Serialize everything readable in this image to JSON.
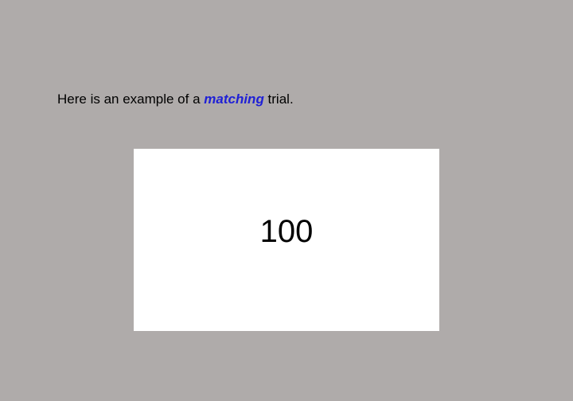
{
  "instruction": {
    "prefix": "Here is an example of a ",
    "emphasis": "matching",
    "suffix": " trial."
  },
  "stimulus": {
    "number": "100"
  },
  "colors": {
    "background": "#afabaa",
    "card": "#ffffff",
    "emphasis": "#1f20d6",
    "text": "#000000"
  }
}
